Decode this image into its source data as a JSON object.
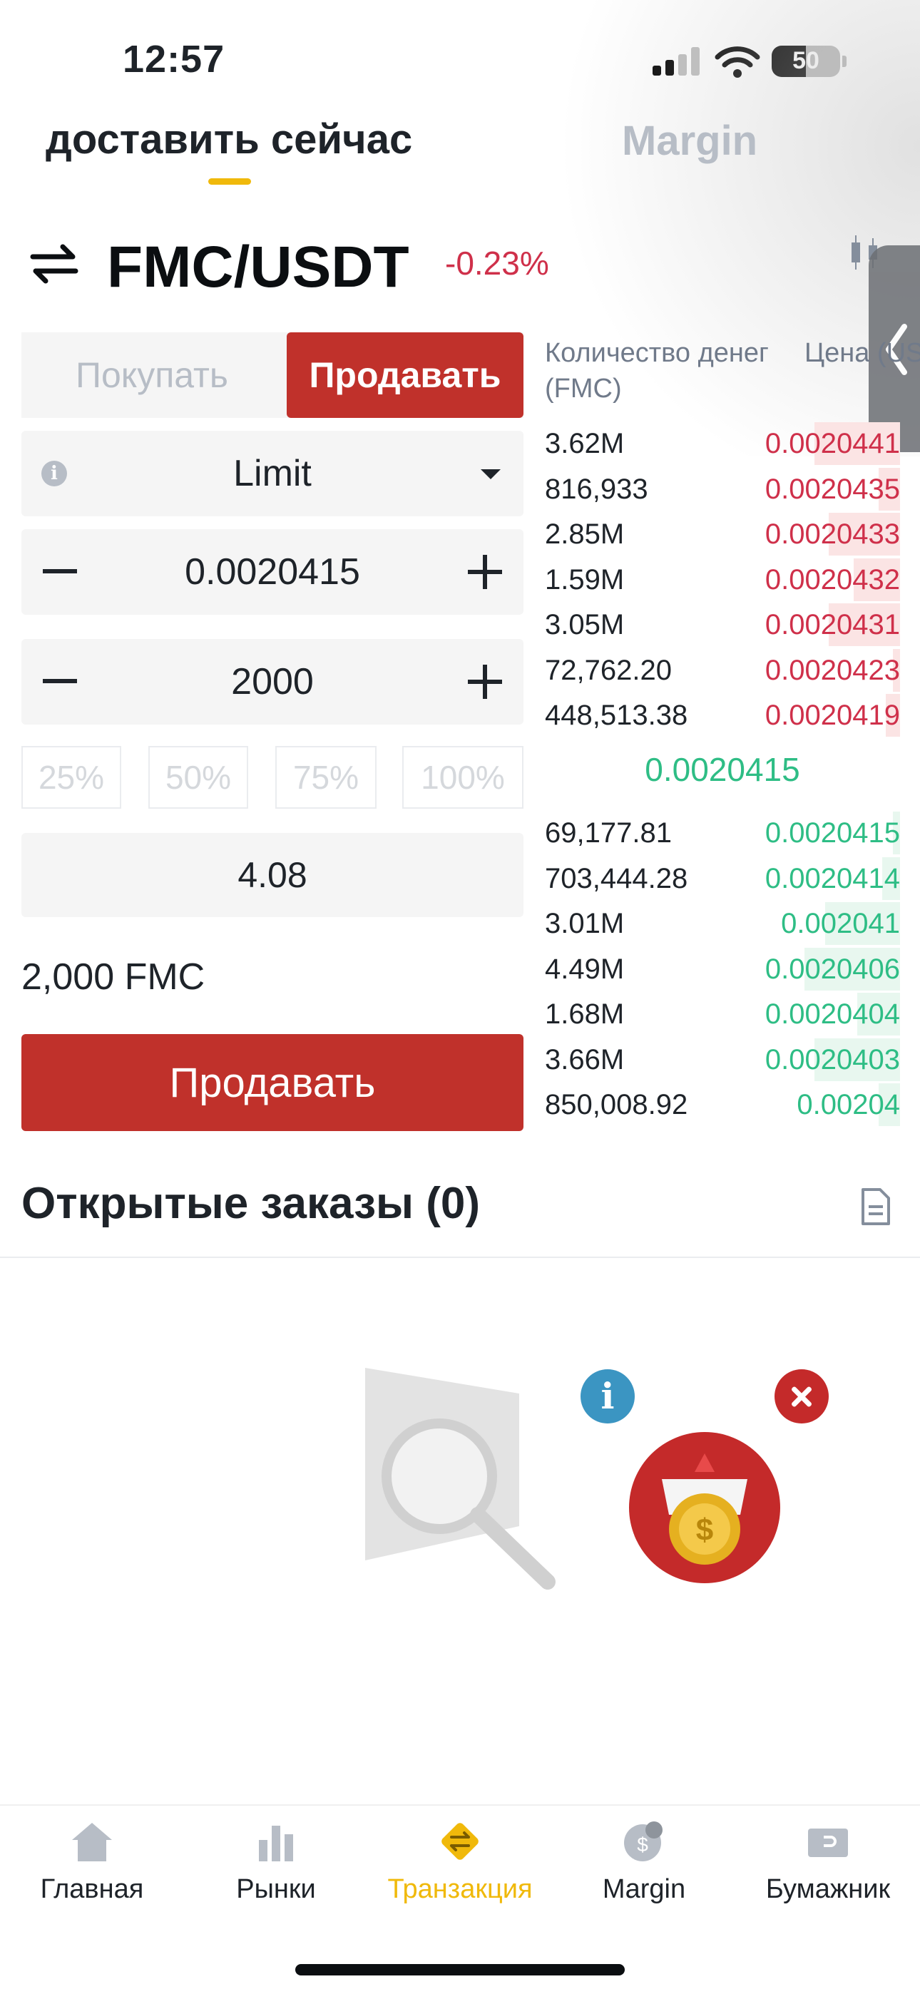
{
  "status": {
    "time": "12:57",
    "battery": "50",
    "battery_level": 0.5
  },
  "tabs": {
    "spot_label": "доставить сейчас",
    "margin_label": "Margin"
  },
  "pair": {
    "name": "FMC/USDT",
    "change": "-0.23%"
  },
  "trade": {
    "buy_label": "Покупать",
    "sell_label": "Продавать",
    "order_type": "Limit",
    "price": "0.0020415",
    "amount": "2000",
    "percents": [
      "25%",
      "50%",
      "75%",
      "100%"
    ],
    "total": "4.08",
    "available": "2,000 FMC",
    "submit_label": "Продавать"
  },
  "orderbook": {
    "qty_header": "Количество денег (FMC)",
    "price_header": "Цена (USDT)",
    "asks": [
      {
        "qty": "3.62M",
        "price": "0.0020441",
        "depth": 0.24
      },
      {
        "qty": "816,933",
        "price": "0.0020435",
        "depth": 0.06
      },
      {
        "qty": "2.85M",
        "price": "0.0020433",
        "depth": 0.2
      },
      {
        "qty": "1.59M",
        "price": "0.0020432",
        "depth": 0.13
      },
      {
        "qty": "3.05M",
        "price": "0.0020431",
        "depth": 0.2
      },
      {
        "qty": "72,762.20",
        "price": "0.0020423",
        "depth": 0.02
      },
      {
        "qty": "448,513.38",
        "price": "0.0020419",
        "depth": 0.04
      }
    ],
    "mid_price": "0.0020415",
    "bids": [
      {
        "qty": "69,177.81",
        "price": "0.0020415",
        "depth": 0.02
      },
      {
        "qty": "703,444.28",
        "price": "0.0020414",
        "depth": 0.05
      },
      {
        "qty": "3.01M",
        "price": "0.002041",
        "depth": 0.21
      },
      {
        "qty": "4.49M",
        "price": "0.0020406",
        "depth": 0.27
      },
      {
        "qty": "1.68M",
        "price": "0.0020404",
        "depth": 0.12
      },
      {
        "qty": "3.66M",
        "price": "0.0020403",
        "depth": 0.24
      },
      {
        "qty": "850,008.92",
        "price": "0.00204",
        "depth": 0.06
      }
    ]
  },
  "open_orders": {
    "title": "Открытые заказы (0)"
  },
  "nav": {
    "items": [
      {
        "label": "Главная",
        "icon": "home-icon",
        "active": false
      },
      {
        "label": "Рынки",
        "icon": "markets-icon",
        "active": false
      },
      {
        "label": "Транзакция",
        "icon": "trade-icon",
        "active": true
      },
      {
        "label": "Margin",
        "icon": "margin-icon",
        "active": false
      },
      {
        "label": "Бумажник",
        "icon": "wallet-icon",
        "active": false
      }
    ]
  },
  "colors": {
    "accent": "#f0b90b",
    "sell": "#c0312b",
    "ask_text": "#cf304a",
    "bid_text": "#2ebd85"
  }
}
